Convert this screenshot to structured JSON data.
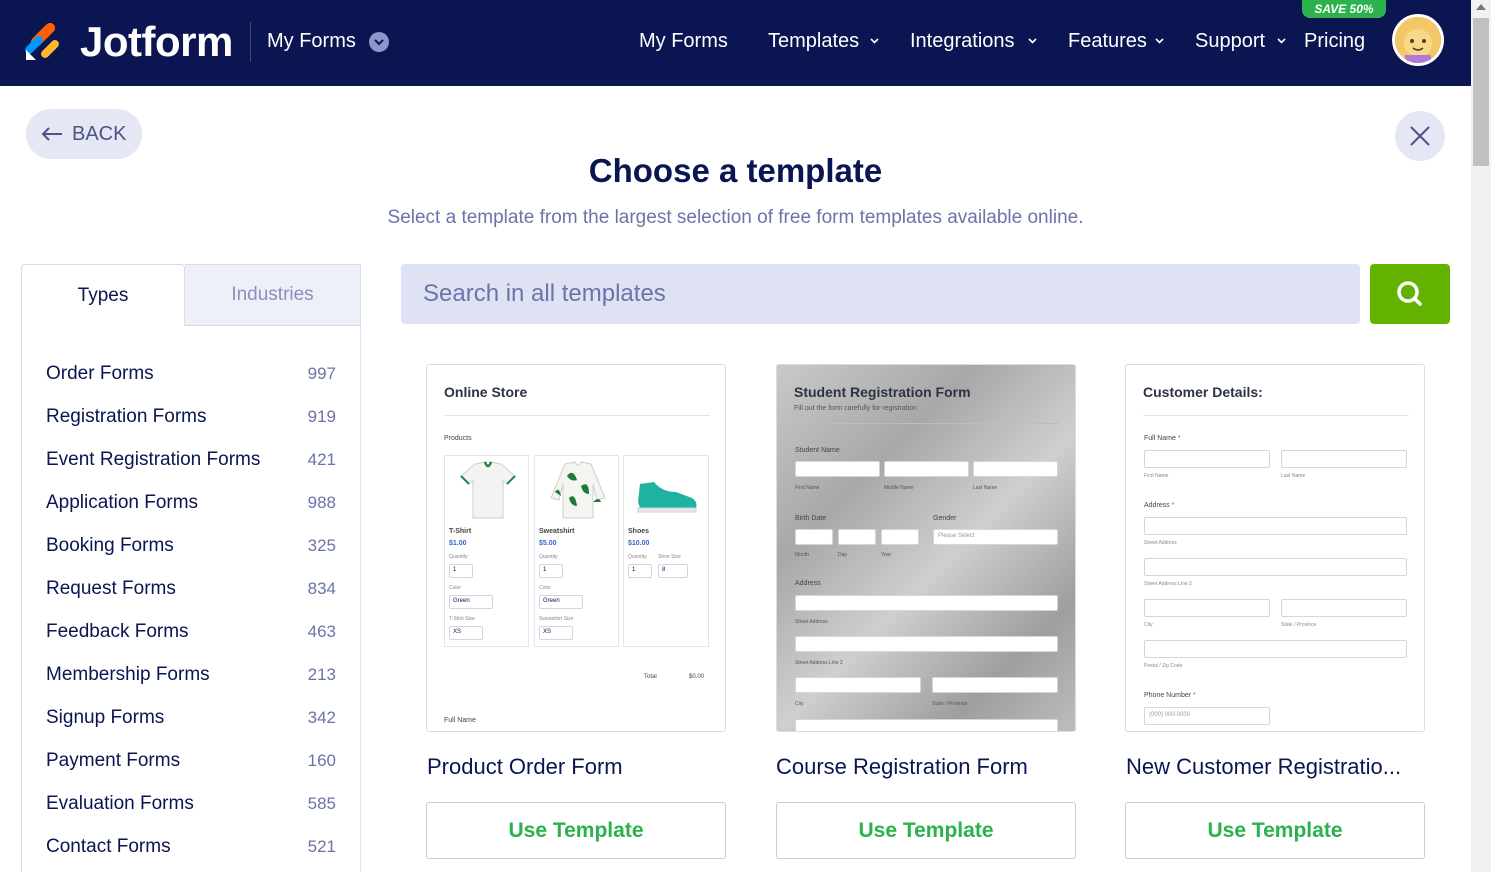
{
  "nav": {
    "brand": "Jotform",
    "my_forms_left": "My Forms",
    "items": [
      {
        "label": "My Forms"
      },
      {
        "label": "Templates"
      },
      {
        "label": "Integrations"
      },
      {
        "label": "Features"
      },
      {
        "label": "Support"
      },
      {
        "label": "Pricing"
      }
    ],
    "save_badge": "SAVE 50%"
  },
  "header": {
    "back_label": "BACK",
    "title": "Choose a template",
    "subtitle": "Select a template from the largest selection of free form templates available online."
  },
  "sidebar": {
    "tabs": [
      {
        "label": "Types"
      },
      {
        "label": "Industries"
      }
    ],
    "categories": [
      {
        "name": "Order Forms",
        "count": "997"
      },
      {
        "name": "Registration Forms",
        "count": "919"
      },
      {
        "name": "Event Registration Forms",
        "count": "421"
      },
      {
        "name": "Application Forms",
        "count": "988"
      },
      {
        "name": "Booking Forms",
        "count": "325"
      },
      {
        "name": "Request Forms",
        "count": "834"
      },
      {
        "name": "Feedback Forms",
        "count": "463"
      },
      {
        "name": "Membership Forms",
        "count": "213"
      },
      {
        "name": "Signup Forms",
        "count": "342"
      },
      {
        "name": "Payment Forms",
        "count": "160"
      },
      {
        "name": "Evaluation Forms",
        "count": "585"
      },
      {
        "name": "Contact Forms",
        "count": "521"
      }
    ]
  },
  "search": {
    "placeholder": "Search in all templates"
  },
  "templates": [
    {
      "title": "Product Order Form",
      "button": "Use Template",
      "preview": {
        "heading": "Online Store",
        "products_label": "Products",
        "items": [
          {
            "name": "T-Shirt",
            "price": "$1.00",
            "qty_label": "Quantity",
            "qty": "1",
            "color_label": "Color",
            "color": "Green",
            "size_label": "T-Shirt Size",
            "size": "XS"
          },
          {
            "name": "Sweatshirt",
            "price": "$5.00",
            "qty_label": "Quantity",
            "qty": "1",
            "color_label": "Color",
            "color": "Green",
            "size_label": "Sweatshirt Size",
            "size": "XS"
          },
          {
            "name": "Shoes",
            "price": "$10.00",
            "qty_label": "Quantity",
            "qty": "1",
            "size_label": "Shoe Size",
            "size": "8"
          }
        ],
        "total_label": "Total",
        "total_value": "$0.00",
        "full_name": "Full Name"
      }
    },
    {
      "title": "Course Registration Form",
      "button": "Use Template",
      "preview": {
        "heading": "Student Registration Form",
        "subheading": "Fill out the form carefully for registration",
        "student_name": "Student Name",
        "first_name": "First Name",
        "middle_name": "Middle Name",
        "last_name": "Last Name",
        "birth_date": "Birth Date",
        "month": "Month",
        "day": "Day",
        "year": "Year",
        "gender": "Gender",
        "gender_placeholder": "Please Select",
        "address": "Address",
        "street": "Street Address",
        "street2": "Street Address Line 2",
        "city": "City",
        "state": "State / Province"
      }
    },
    {
      "title": "New Customer Registratio...",
      "button": "Use Template",
      "preview": {
        "heading": "Customer Details:",
        "full_name": "Full Name",
        "first_name": "First Name",
        "last_name": "Last Name",
        "address": "Address",
        "street": "Street Address",
        "street2": "Street Address Line 2",
        "city": "City",
        "state": "State / Province",
        "postal": "Postal / Zip Code",
        "phone": "Phone Number",
        "phone_placeholder": "(000) 000-0000",
        "required_mark": "*"
      }
    }
  ],
  "colors": {
    "nav_bg": "#0a1551",
    "accent_green": "#64b200",
    "button_text_green": "#2bb24c",
    "search_bg": "#dfe2f3"
  }
}
